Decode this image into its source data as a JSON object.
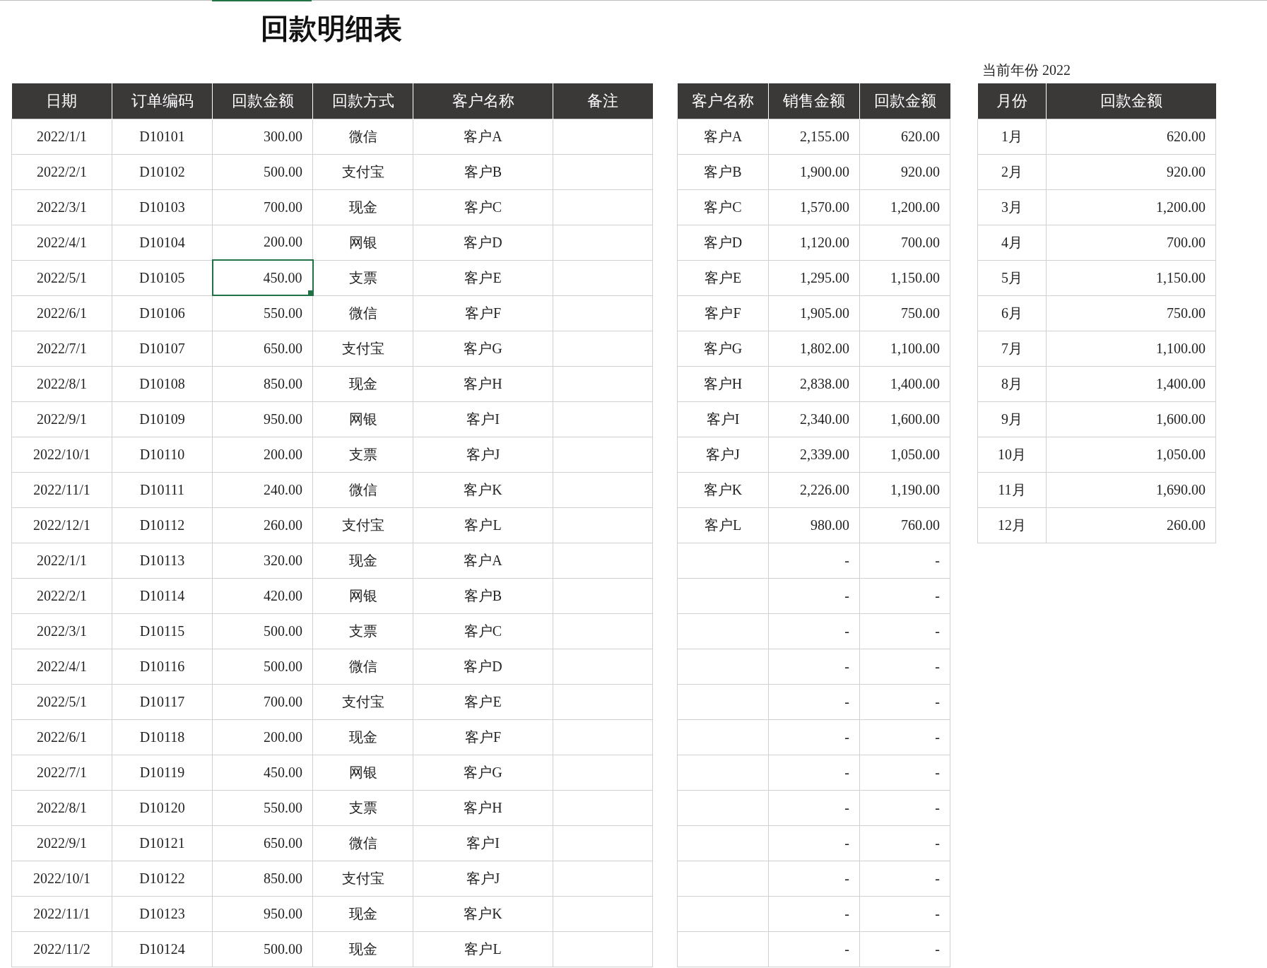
{
  "title": "回款明细表",
  "year_label": "当前年份 2022",
  "detail_table": {
    "columns": [
      "日期",
      "订单编码",
      "回款金额",
      "回款方式",
      "客户名称",
      "备注"
    ],
    "rows": [
      {
        "date": "2022/1/1",
        "order": "D10101",
        "amount": "300.00",
        "method": "微信",
        "customer": "客户A",
        "amount_selected": false
      },
      {
        "date": "2022/2/1",
        "order": "D10102",
        "amount": "500.00",
        "method": "支付宝",
        "customer": "客户B",
        "amount_selected": false
      },
      {
        "date": "2022/3/1",
        "order": "D10103",
        "amount": "700.00",
        "method": "现金",
        "customer": "客户C",
        "amount_selected": false
      },
      {
        "date": "2022/4/1",
        "order": "D10104",
        "amount": "200.00",
        "method": "网银",
        "customer": "客户D",
        "amount_selected": false
      },
      {
        "date": "2022/5/1",
        "order": "D10105",
        "amount": "450.00",
        "method": "支票",
        "customer": "客户E",
        "amount_selected": true
      },
      {
        "date": "2022/6/1",
        "order": "D10106",
        "amount": "550.00",
        "method": "微信",
        "customer": "客户F",
        "amount_selected": false
      },
      {
        "date": "2022/7/1",
        "order": "D10107",
        "amount": "650.00",
        "method": "支付宝",
        "customer": "客户G",
        "amount_selected": false
      },
      {
        "date": "2022/8/1",
        "order": "D10108",
        "amount": "850.00",
        "method": "现金",
        "customer": "客户H",
        "amount_selected": false
      },
      {
        "date": "2022/9/1",
        "order": "D10109",
        "amount": "950.00",
        "method": "网银",
        "customer": "客户I",
        "amount_selected": false
      },
      {
        "date": "2022/10/1",
        "order": "D10110",
        "amount": "200.00",
        "method": "支票",
        "customer": "客户J",
        "amount_selected": false
      },
      {
        "date": "2022/11/1",
        "order": "D10111",
        "amount": "240.00",
        "method": "微信",
        "customer": "客户K",
        "amount_selected": false
      },
      {
        "date": "2022/12/1",
        "order": "D10112",
        "amount": "260.00",
        "method": "支付宝",
        "customer": "客户L",
        "amount_selected": false
      },
      {
        "date": "2022/1/1",
        "order": "D10113",
        "amount": "320.00",
        "method": "现金",
        "customer": "客户A",
        "amount_selected": false
      },
      {
        "date": "2022/2/1",
        "order": "D10114",
        "amount": "420.00",
        "method": "网银",
        "customer": "客户B",
        "amount_selected": false
      },
      {
        "date": "2022/3/1",
        "order": "D10115",
        "amount": "500.00",
        "method": "支票",
        "customer": "客户C",
        "amount_selected": false
      },
      {
        "date": "2022/4/1",
        "order": "D10116",
        "amount": "500.00",
        "method": "微信",
        "customer": "客户D",
        "amount_selected": false
      },
      {
        "date": "2022/5/1",
        "order": "D10117",
        "amount": "700.00",
        "method": "支付宝",
        "customer": "客户E",
        "amount_selected": false
      },
      {
        "date": "2022/6/1",
        "order": "D10118",
        "amount": "200.00",
        "method": "现金",
        "customer": "客户F",
        "amount_selected": false
      },
      {
        "date": "2022/7/1",
        "order": "D10119",
        "amount": "450.00",
        "method": "网银",
        "customer": "客户G",
        "amount_selected": false
      },
      {
        "date": "2022/8/1",
        "order": "D10120",
        "amount": "550.00",
        "method": "支票",
        "customer": "客户H",
        "amount_selected": false
      },
      {
        "date": "2022/9/1",
        "order": "D10121",
        "amount": "650.00",
        "method": "微信",
        "customer": "客户I",
        "amount_selected": false
      },
      {
        "date": "2022/10/1",
        "order": "D10122",
        "amount": "850.00",
        "method": "支付宝",
        "customer": "客户J",
        "amount_selected": false
      },
      {
        "date": "2022/11/1",
        "order": "D10123",
        "amount": "950.00",
        "method": "现金",
        "customer": "客户K",
        "amount_selected": false
      },
      {
        "date": "2022/11/2",
        "order": "D10124",
        "amount": "500.00",
        "method": "现金",
        "customer": "客户L",
        "amount_selected": false
      }
    ]
  },
  "customer_table": {
    "columns": [
      "客户名称",
      "销售金额",
      "回款金额"
    ],
    "rows": [
      {
        "customer": "客户A",
        "sales": "2,155.00",
        "received": "620.00"
      },
      {
        "customer": "客户B",
        "sales": "1,900.00",
        "received": "920.00"
      },
      {
        "customer": "客户C",
        "sales": "1,570.00",
        "received": "1,200.00"
      },
      {
        "customer": "客户D",
        "sales": "1,120.00",
        "received": "700.00"
      },
      {
        "customer": "客户E",
        "sales": "1,295.00",
        "received": "1,150.00"
      },
      {
        "customer": "客户F",
        "sales": "1,905.00",
        "received": "750.00"
      },
      {
        "customer": "客户G",
        "sales": "1,802.00",
        "received": "1,100.00"
      },
      {
        "customer": "客户H",
        "sales": "2,838.00",
        "received": "1,400.00"
      },
      {
        "customer": "客户I",
        "sales": "2,340.00",
        "received": "1,600.00"
      },
      {
        "customer": "客户J",
        "sales": "2,339.00",
        "received": "1,050.00"
      },
      {
        "customer": "客户K",
        "sales": "2,226.00",
        "received": "1,190.00"
      },
      {
        "customer": "客户L",
        "sales": "980.00",
        "received": "760.00"
      },
      {
        "sales": "-",
        "received": "-"
      },
      {
        "sales": "-",
        "received": "-"
      },
      {
        "sales": "-",
        "received": "-"
      },
      {
        "sales": "-",
        "received": "-"
      },
      {
        "sales": "-",
        "received": "-"
      },
      {
        "sales": "-",
        "received": "-"
      },
      {
        "sales": "-",
        "received": "-"
      },
      {
        "sales": "-",
        "received": "-"
      },
      {
        "sales": "-",
        "received": "-"
      },
      {
        "sales": "-",
        "received": "-"
      },
      {
        "sales": "-",
        "received": "-"
      },
      {
        "sales": "-",
        "received": "-"
      }
    ]
  },
  "month_table": {
    "columns": [
      "月份",
      "回款金额"
    ],
    "rows": [
      {
        "month": "1月",
        "amount": "620.00"
      },
      {
        "month": "2月",
        "amount": "920.00"
      },
      {
        "month": "3月",
        "amount": "1,200.00"
      },
      {
        "month": "4月",
        "amount": "700.00"
      },
      {
        "month": "5月",
        "amount": "1,150.00"
      },
      {
        "month": "6月",
        "amount": "750.00"
      },
      {
        "month": "7月",
        "amount": "1,100.00"
      },
      {
        "month": "8月",
        "amount": "1,400.00"
      },
      {
        "month": "9月",
        "amount": "1,600.00"
      },
      {
        "month": "10月",
        "amount": "1,050.00"
      },
      {
        "month": "11月",
        "amount": "1,690.00"
      },
      {
        "month": "12月",
        "amount": "260.00"
      }
    ]
  }
}
